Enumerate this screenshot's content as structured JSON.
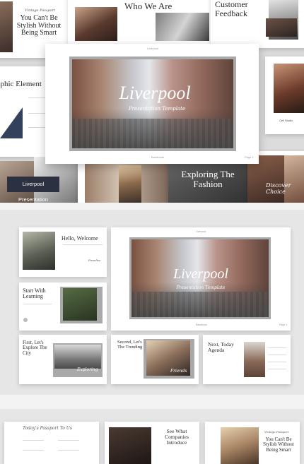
{
  "hero": {
    "title": "Liverpool",
    "subtitle": "Presentation Template",
    "brand": "Liverpool",
    "footer_left": "Bandbook",
    "footer_right": "Page 1",
    "badge": "Liverpool Presentation"
  },
  "collage": {
    "who_we_are": "Who We Are",
    "customer_feedback": "Customer Feedback",
    "stylish_small_script": "Vintage Passport",
    "stylish": "You Can't Be Stylish Without Being Smart",
    "graphic_element": "raphic Element",
    "exploring": "Exploring The Fashion",
    "discover": "Discover Choice"
  },
  "grid": {
    "hello": "Hello, Welcome",
    "hello_script": "Paradise",
    "start": "Start With Learning",
    "first": "First, Let's Explore The City",
    "first_script": "Exploring",
    "second": "Second, Let's Explore The Trending",
    "second_script": "Friends",
    "next": "Next, Today Agenda",
    "big_title": "Liverpool",
    "big_subtitle": "Presentation Template",
    "big_brand": "Liverpool",
    "big_footer": "Bandbook",
    "big_page": "Page 1"
  },
  "bottom": {
    "handwritten": "Today's Passport To Us",
    "what": "See What Companies Introduce",
    "stylish_small": "Vintage Passport",
    "stylish": "You Can't Be Stylish Without Being Smart"
  },
  "colors": {
    "background": "#e6e6e6",
    "slide": "#ffffff",
    "badge": "#2b3140",
    "accent_navy": "#33415c",
    "frame_gray": "#a9a9a9"
  }
}
